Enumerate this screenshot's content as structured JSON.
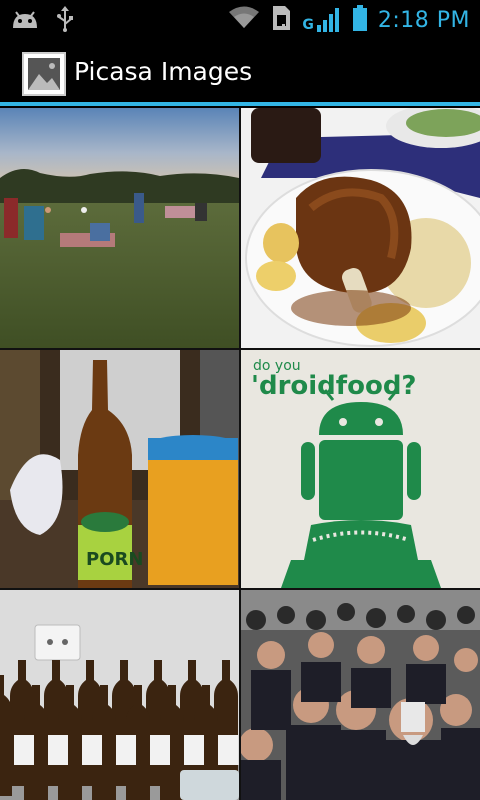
{
  "status_bar": {
    "time": "2:18 PM",
    "network_type": "G",
    "icons": [
      "android-debug-icon",
      "usb-icon",
      "wifi-icon",
      "sim-icon",
      "signal-icon",
      "battery-icon"
    ]
  },
  "action_bar": {
    "title": "Picasa Images",
    "icon": "gallery-image-icon",
    "accent_color": "#33b5e5"
  },
  "photos": [
    {
      "name": "park-photo",
      "subject": "people relaxing on a grass field at dusk"
    },
    {
      "name": "food-photo",
      "subject": "roasted pork knuckle with potatoes and sauerkraut"
    },
    {
      "name": "beer-photo",
      "subject": "beer bottle and cup at a bar"
    },
    {
      "name": "droidfood-photo",
      "subject": "do you droidfood? android poster",
      "text": "do you 'droidfood?"
    },
    {
      "name": "bottles-photo",
      "subject": "rows of beer bottles on a table"
    },
    {
      "name": "crowd-photo",
      "subject": "crowd of people in suits"
    }
  ]
}
